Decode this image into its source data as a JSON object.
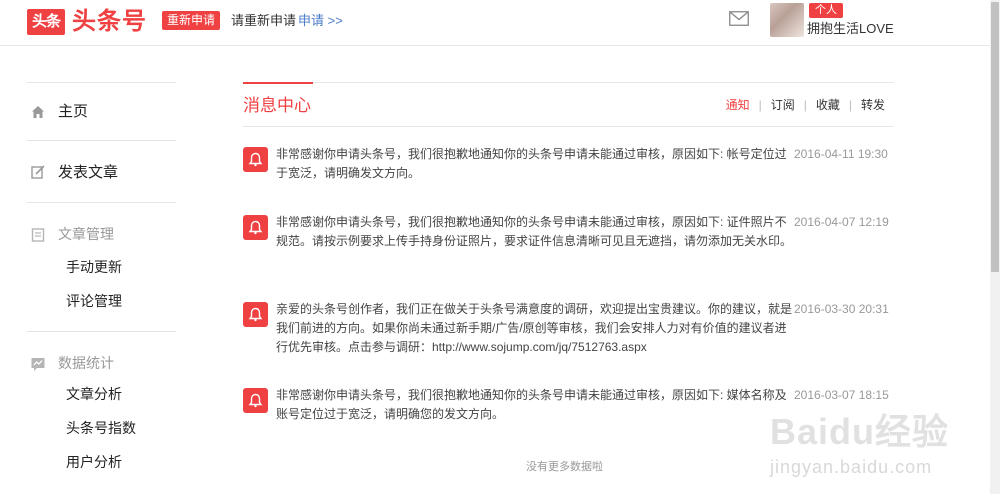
{
  "header": {
    "logo_box": "头条",
    "logo_text": "头条号",
    "reapply_badge": "重新申请",
    "reapply_message": "请重新申请",
    "reapply_link": "申请 >>",
    "role_badge": "个人",
    "username": "拥抱生活LOVE",
    "icons": {
      "mail": "mail-icon",
      "avatar": "avatar"
    }
  },
  "sidebar": {
    "home": {
      "label": "主页",
      "icon": "home-icon"
    },
    "publish": {
      "label": "发表文章",
      "icon": "edit-icon"
    },
    "article_mgmt": {
      "label": "文章管理",
      "icon": "document-icon",
      "items": [
        "手动更新",
        "评论管理"
      ]
    },
    "stats": {
      "label": "数据统计",
      "icon": "chart-icon",
      "items": [
        "文章分析",
        "头条号指数",
        "用户分析"
      ]
    }
  },
  "main": {
    "title": "消息中心",
    "tabs": [
      "通知",
      "订阅",
      "收藏",
      "转发"
    ],
    "active_tab": "通知",
    "messages": [
      {
        "text": "非常感谢你申请头条号，我们很抱歉地通知你的头条号申请未能通过审核，原因如下: 帐号定位过于宽泛，请明确发文方向。",
        "time": "2016-04-11 19:30"
      },
      {
        "text": "非常感谢你申请头条号，我们很抱歉地通知你的头条号申请未能通过审核，原因如下: 证件照片不规范。请按示例要求上传手持身份证照片，要求证件信息清晰可见且无遮挡，请勿添加无关水印。",
        "time": "2016-04-07 12:19"
      },
      {
        "text": "亲爱的头条号创作者，我们正在做关于头条号满意度的调研，欢迎提出宝贵建议。你的建议，就是我们前进的方向。如果你尚未通过新手期/广告/原创等审核，我们会安排人力对有价值的建议者进行优先审核。点击参与调研：http://www.sojump.com/jq/7512763.aspx",
        "time": "2016-03-30 20:31"
      },
      {
        "text": "非常感谢你申请头条号，我们很抱歉地通知你的头条号申请未能通过审核，原因如下: 媒体名称及账号定位过于宽泛，请明确您的发文方向。",
        "time": "2016-03-07 18:15"
      }
    ],
    "no_more": "没有更多数据啦"
  },
  "watermark": {
    "main": "Baidu经验",
    "sub": "jingyan.baidu.com"
  },
  "colors": {
    "accent": "#f04142",
    "link": "#4a7cc7",
    "muted": "#999999"
  }
}
